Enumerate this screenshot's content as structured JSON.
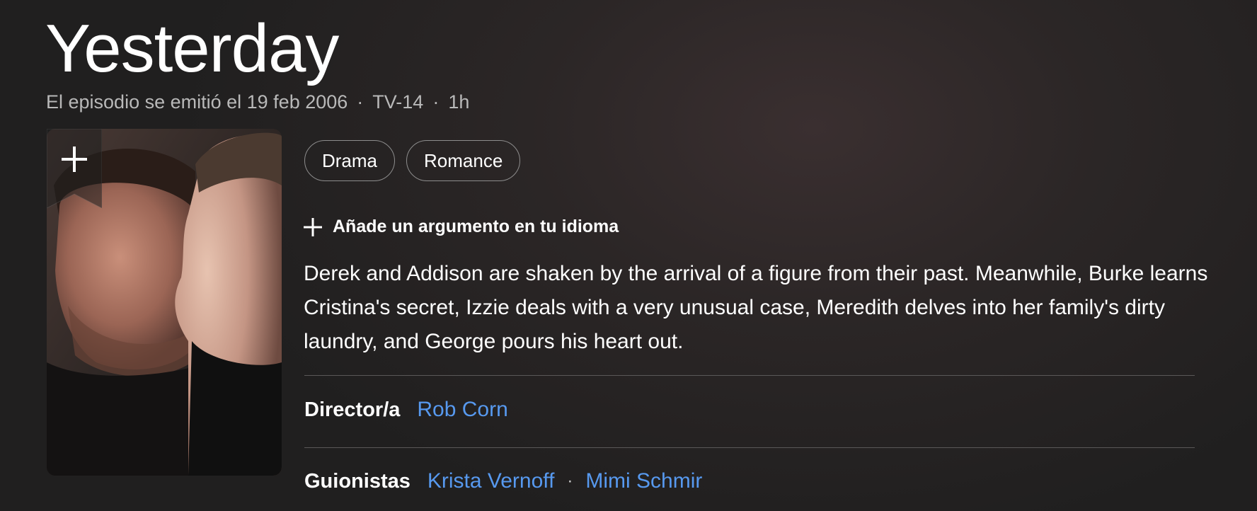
{
  "episode": {
    "title": "Yesterday",
    "aired": "El episodio se emitió el 19 feb 2006",
    "rating": "TV-14",
    "runtime": "1h",
    "separator": "·"
  },
  "genres": [
    "Drama",
    "Romance"
  ],
  "add_plot_label": "Añade un argumento en tu idioma",
  "plot": "Derek and Addison are shaken by the arrival of a figure from their past. Meanwhile, Burke learns Cristina's secret, Izzie deals with a very unusual case, Meredith delves into her family's dirty laundry, and George pours his heart out.",
  "credits": {
    "director": {
      "label": "Director/a",
      "names": [
        "Rob Corn"
      ]
    },
    "writers": {
      "label": "Guionistas",
      "names": [
        "Krista Vernoff",
        "Mimi Schmir"
      ]
    }
  },
  "colors": {
    "link": "#5799ef",
    "muted_text": "#b9b9b9",
    "chip_border": "#8d8d8d"
  },
  "icons": {
    "watchlist": "plus-ribbon-icon",
    "add_plot": "plus-icon"
  }
}
